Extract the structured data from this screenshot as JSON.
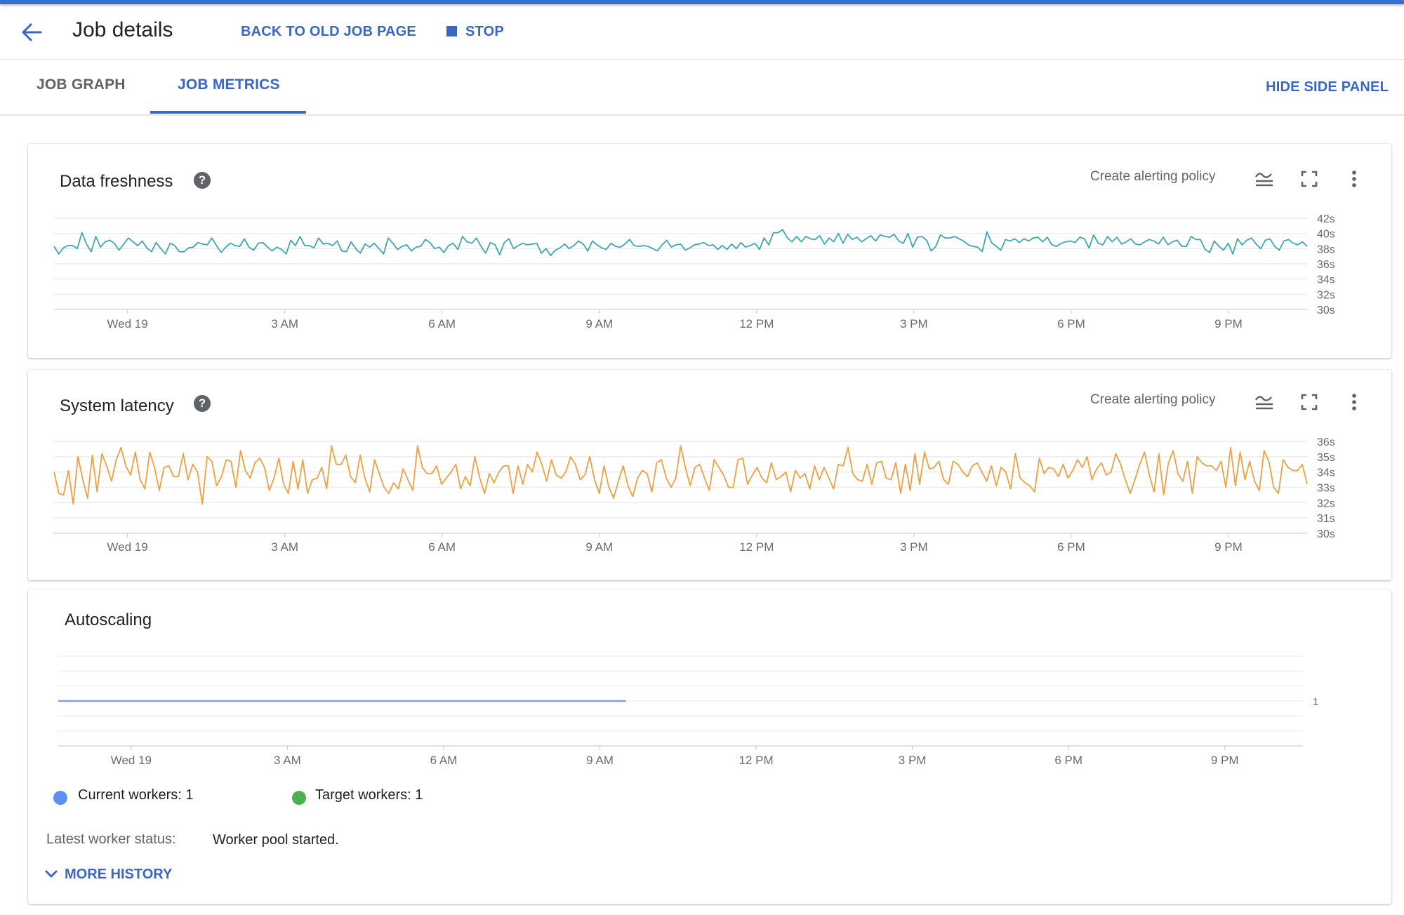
{
  "header": {
    "title": "Job details",
    "back_to_old_label": "BACK TO OLD JOB PAGE",
    "stop_label": "STOP",
    "accent_color": "#3b66c4"
  },
  "tabs": [
    {
      "label": "JOB GRAPH",
      "active": false
    },
    {
      "label": "JOB METRICS",
      "active": true
    }
  ],
  "hide_side_panel_label": "HIDE SIDE PANEL",
  "cards": {
    "data_freshness": {
      "title": "Data freshness",
      "alert_label": "Create alerting policy",
      "icons": [
        "help-icon",
        "legend-toggle-icon",
        "fullscreen-icon",
        "more-vert-icon"
      ]
    },
    "system_latency": {
      "title": "System latency",
      "alert_label": "Create alerting policy",
      "icons": [
        "help-icon",
        "legend-toggle-icon",
        "fullscreen-icon",
        "more-vert-icon"
      ]
    },
    "autoscaling": {
      "title": "Autoscaling",
      "current_workers_label": "Current workers:",
      "current_workers_value": "1",
      "target_workers_label": "Target workers:",
      "target_workers_value": "1",
      "current_color": "#5b8ff0",
      "target_color": "#4caf50",
      "latest_status_label": "Latest worker status:",
      "latest_status_value": "Worker pool started.",
      "more_history_label": "MORE HISTORY"
    }
  },
  "chart_data": [
    {
      "type": "line",
      "title": "Data freshness",
      "xlabel": "",
      "ylabel": "",
      "x_tick_labels": [
        "Wed 19",
        "3 AM",
        "6 AM",
        "9 AM",
        "12 PM",
        "3 PM",
        "6 PM",
        "9 PM"
      ],
      "x_tick_hours": [
        0,
        3,
        6,
        9,
        12,
        15,
        18,
        21
      ],
      "x_range_hours": [
        -1.4,
        22.5
      ],
      "y_tick_labels": [
        "42s",
        "40s",
        "38s",
        "36s",
        "34s",
        "32s",
        "30s"
      ],
      "y_ticks": [
        42,
        40,
        38,
        36,
        34,
        32,
        30
      ],
      "ylim": [
        30,
        42
      ],
      "grid": true,
      "color": "#3ea8b0",
      "series": [
        {
          "name": "Data freshness",
          "unit": "s",
          "values": [
            38.3,
            37.3,
            38.1,
            38.4,
            38.4,
            38.0,
            40.1,
            38.6,
            37.6,
            39.6,
            38.2,
            38.9,
            39.1,
            38.7,
            37.8,
            38.6,
            39.4,
            38.9,
            38.4,
            39.0,
            38.1,
            37.6,
            38.8,
            38.0,
            37.3,
            38.7,
            38.4,
            37.6,
            37.6,
            38.1,
            38.2,
            38.8,
            38.6,
            38.5,
            39.4,
            38.4,
            37.5,
            38.2,
            38.7,
            38.4,
            38.3,
            39.3,
            38.2,
            37.8,
            38.7,
            38.8,
            38.2,
            37.7,
            38.2,
            37.9,
            37.3,
            39.1,
            38.4,
            39.6,
            38.4,
            38.4,
            38.1,
            39.4,
            38.6,
            38.7,
            38.4,
            39.0,
            37.7,
            37.6,
            38.9,
            38.0,
            37.4,
            38.6,
            38.2,
            38.7,
            38.0,
            37.3,
            39.4,
            38.7,
            37.9,
            38.3,
            38.5,
            37.7,
            38.2,
            38.3,
            39.2,
            38.8,
            38.0,
            38.2,
            37.5,
            38.4,
            38.7,
            37.9,
            39.6,
            38.9,
            38.7,
            39.4,
            38.3,
            37.4,
            38.8,
            38.5,
            37.2,
            38.8,
            39.3,
            38.0,
            38.4,
            38.7,
            38.5,
            38.6,
            38.7,
            37.4,
            38.0,
            37.1,
            37.8,
            38.1,
            38.6,
            38.0,
            38.4,
            39.0,
            38.6,
            37.7,
            39.0,
            38.5,
            38.1,
            37.9,
            38.7,
            38.3,
            38.2,
            38.6,
            39.2,
            38.4,
            38.3,
            38.4,
            38.3,
            38.0,
            37.7,
            38.5,
            39.1,
            38.2,
            38.5,
            38.6,
            37.8,
            38.1,
            38.5,
            38.6,
            38.8,
            38.4,
            38.5,
            37.9,
            38.4,
            37.9,
            38.6,
            38.0,
            38.8,
            38.2,
            38.4,
            38.7,
            37.9,
            39.4,
            38.5,
            40.1,
            40.1,
            40.5,
            39.4,
            38.9,
            39.6,
            38.9,
            39.6,
            39.3,
            39.2,
            39.7,
            38.6,
            39.4,
            38.9,
            40.0,
            38.7,
            39.9,
            39.2,
            39.5,
            38.9,
            39.3,
            39.7,
            39.0,
            39.8,
            39.6,
            39.5,
            39.9,
            39.0,
            38.7,
            40.0,
            38.2,
            39.5,
            39.6,
            39.1,
            37.7,
            38.3,
            39.8,
            39.4,
            39.4,
            39.6,
            39.3,
            39.0,
            38.5,
            38.3,
            38.2,
            37.6,
            40.2,
            38.8,
            38.3,
            37.8,
            39.2,
            39.0,
            39.3,
            38.8,
            39.3,
            39.0,
            39.4,
            39.5,
            38.9,
            39.5,
            38.5,
            38.3,
            38.7,
            38.9,
            39.0,
            38.8,
            39.5,
            39.3,
            38.1,
            39.8,
            38.7,
            38.5,
            39.6,
            38.9,
            39.5,
            38.6,
            38.9,
            39.3,
            38.6,
            38.5,
            38.9,
            39.2,
            39.0,
            38.6,
            39.5,
            38.5,
            38.9,
            39.1,
            38.3,
            38.3,
            39.6,
            39.2,
            39.2,
            37.9,
            37.5,
            39.0,
            38.3,
            37.8,
            38.7,
            37.3,
            39.3,
            38.5,
            39.1,
            39.4,
            38.6,
            38.0,
            39.1,
            39.3,
            38.3,
            37.8,
            39.0,
            39.2,
            38.7,
            38.5,
            38.9,
            38.3
          ]
        }
      ]
    },
    {
      "type": "line",
      "title": "System latency",
      "xlabel": "",
      "ylabel": "",
      "x_tick_labels": [
        "Wed 19",
        "3 AM",
        "6 AM",
        "9 AM",
        "12 PM",
        "3 PM",
        "6 PM",
        "9 PM"
      ],
      "x_tick_hours": [
        0,
        3,
        6,
        9,
        12,
        15,
        18,
        21
      ],
      "x_range_hours": [
        -1.4,
        22.5
      ],
      "y_tick_labels": [
        "36s",
        "35s",
        "34s",
        "33s",
        "32s",
        "31s",
        "30s"
      ],
      "y_ticks": [
        36,
        35,
        34,
        33,
        32,
        31,
        30
      ],
      "ylim": [
        30,
        36
      ],
      "grid": true,
      "color": "#f0a040",
      "series": [
        {
          "name": "System latency",
          "unit": "s",
          "values": [
            34.0,
            32.6,
            32.5,
            34.1,
            31.9,
            35.0,
            33.5,
            32.3,
            35.1,
            32.7,
            35.2,
            34.4,
            33.4,
            34.8,
            35.6,
            34.4,
            33.8,
            35.3,
            33.5,
            32.9,
            35.3,
            34.3,
            32.8,
            34.3,
            34.4,
            33.7,
            33.7,
            35.2,
            33.5,
            34.5,
            34.0,
            31.9,
            35.0,
            34.7,
            33.1,
            33.7,
            34.8,
            34.7,
            33.0,
            35.4,
            34.1,
            33.6,
            34.6,
            34.9,
            34.3,
            32.8,
            33.6,
            34.9,
            33.2,
            32.6,
            34.7,
            32.9,
            34.8,
            32.6,
            33.5,
            33.6,
            34.3,
            32.9,
            35.7,
            34.5,
            34.5,
            35.1,
            33.7,
            33.3,
            35.1,
            33.6,
            32.7,
            34.8,
            33.9,
            33.0,
            32.6,
            33.3,
            32.9,
            34.2,
            33.5,
            32.8,
            35.7,
            34.3,
            33.9,
            33.9,
            34.4,
            33.2,
            33.6,
            34.0,
            34.5,
            32.9,
            33.7,
            33.1,
            35.0,
            33.6,
            32.6,
            33.9,
            33.3,
            34.0,
            34.4,
            34.4,
            32.6,
            34.4,
            33.2,
            34.5,
            34.0,
            35.3,
            34.5,
            33.4,
            34.8,
            33.8,
            33.6,
            34.0,
            35.0,
            34.5,
            33.5,
            33.8,
            35.0,
            33.5,
            32.6,
            34.4,
            33.0,
            32.3,
            33.4,
            34.4,
            33.1,
            32.4,
            33.6,
            34.1,
            33.9,
            32.7,
            34.6,
            34.8,
            33.6,
            33.0,
            33.6,
            35.7,
            34.3,
            33.1,
            34.3,
            34.5,
            33.6,
            32.8,
            34.8,
            34.3,
            33.8,
            33.0,
            33.0,
            34.8,
            34.9,
            33.2,
            33.8,
            34.3,
            33.6,
            33.3,
            34.6,
            33.5,
            33.7,
            34.0,
            32.7,
            34.1,
            33.6,
            33.9,
            32.9,
            34.4,
            33.5,
            34.3,
            33.6,
            32.9,
            34.5,
            34.4,
            35.6,
            33.9,
            33.5,
            33.4,
            34.5,
            33.2,
            34.6,
            34.7,
            33.6,
            33.5,
            34.6,
            32.6,
            34.5,
            32.8,
            35.2,
            33.2,
            35.3,
            34.2,
            34.3,
            34.7,
            33.5,
            33.2,
            34.7,
            34.5,
            34.0,
            33.7,
            34.4,
            34.6,
            34.0,
            33.4,
            34.4,
            33.1,
            34.3,
            34.0,
            32.9,
            35.2,
            33.6,
            33.3,
            33.1,
            32.7,
            34.9,
            33.9,
            34.3,
            34.2,
            33.7,
            34.5,
            33.6,
            34.1,
            34.8,
            34.3,
            35.0,
            33.5,
            34.2,
            34.6,
            33.8,
            34.0,
            35.2,
            34.5,
            33.5,
            32.6,
            33.5,
            34.5,
            35.3,
            33.8,
            32.7,
            35.2,
            32.5,
            34.6,
            35.4,
            33.9,
            33.4,
            34.7,
            32.6,
            35.0,
            34.6,
            34.4,
            34.4,
            34.1,
            34.7,
            33.0,
            35.6,
            33.1,
            35.3,
            33.5,
            34.7,
            33.4,
            32.8,
            35.4,
            34.7,
            33.0,
            32.6,
            34.8,
            34.3,
            34.1,
            34.1,
            34.5,
            33.2
          ]
        }
      ]
    },
    {
      "type": "line",
      "title": "Autoscaling",
      "xlabel": "",
      "ylabel": "",
      "x_tick_labels": [
        "Wed 19",
        "3 AM",
        "6 AM",
        "9 AM",
        "12 PM",
        "3 PM",
        "6 PM",
        "9 PM"
      ],
      "x_tick_hours": [
        0,
        3,
        6,
        9,
        12,
        15,
        18,
        21
      ],
      "x_range_hours": [
        -1.4,
        22.5
      ],
      "y_tick_labels": [
        "1"
      ],
      "y_ticks": [
        1
      ],
      "ylim": [
        0,
        2
      ],
      "grid": true,
      "series": [
        {
          "name": "Current workers",
          "color": "#7ea2e0",
          "x_hours": [
            -1.4,
            9.5
          ],
          "values": [
            1,
            1
          ]
        }
      ],
      "legend": [
        {
          "label": "Current workers: 1",
          "color": "#5b8ff0"
        },
        {
          "label": "Target workers: 1",
          "color": "#4caf50"
        }
      ]
    }
  ]
}
